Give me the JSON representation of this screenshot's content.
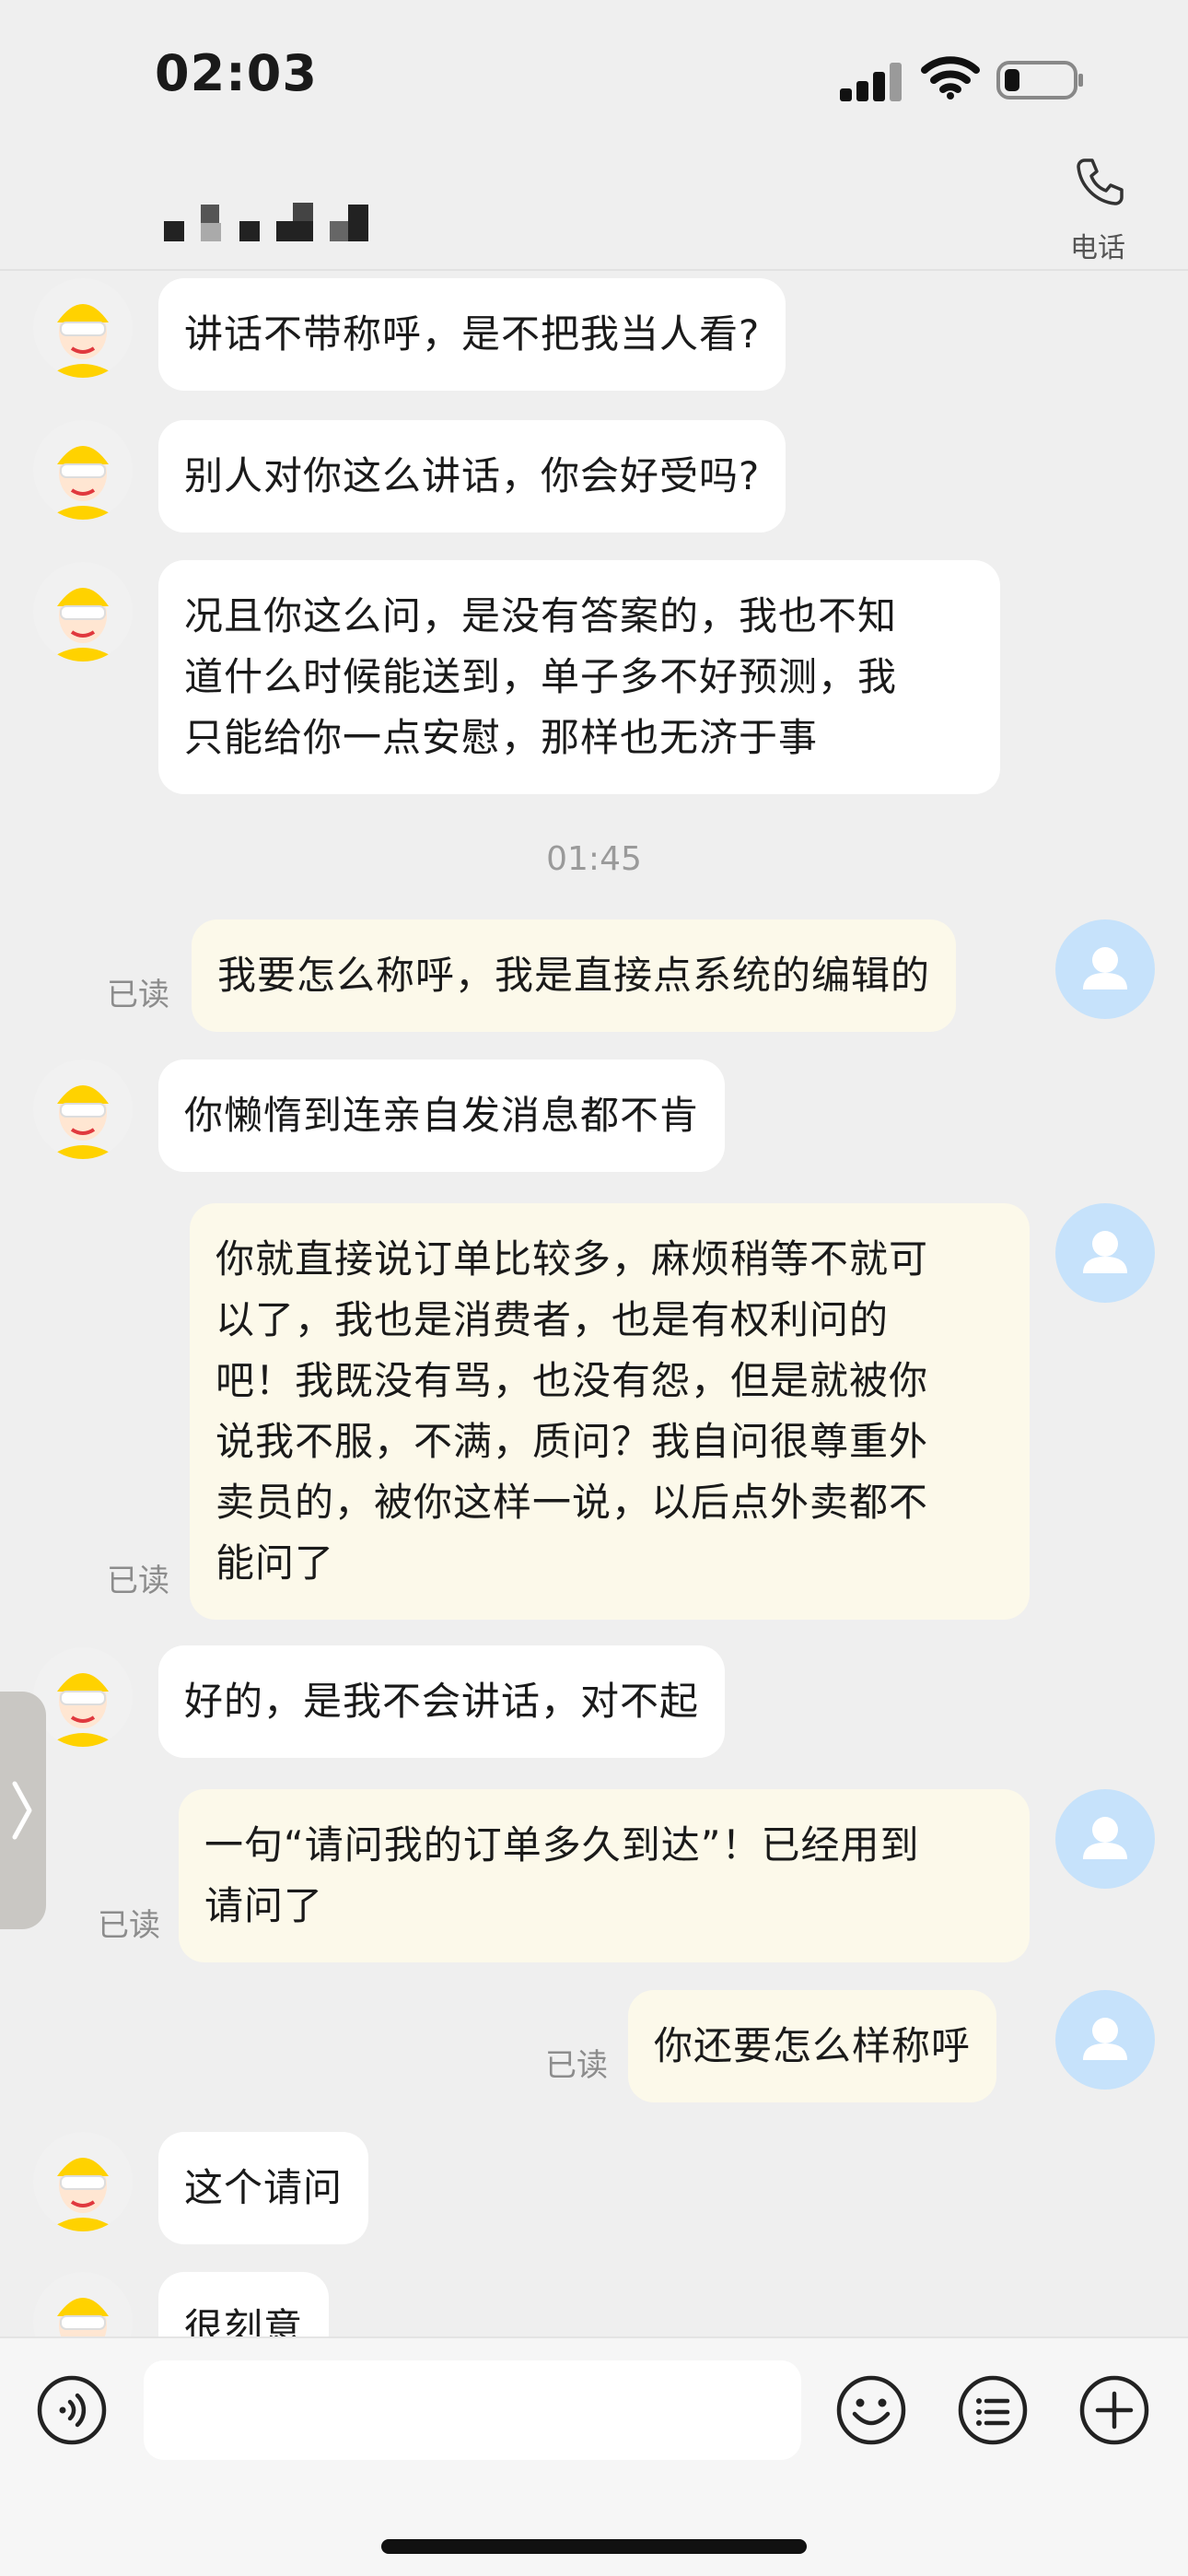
{
  "status_bar": {
    "time": "02:03"
  },
  "header": {
    "phone_label": "电话"
  },
  "messages": [
    {
      "side": "in",
      "text": "讲话不带称呼，是不把我当人看?"
    },
    {
      "side": "in",
      "text": "别人对你这么讲话，你会好受吗?"
    },
    {
      "side": "in",
      "lines": [
        "况且你这么问，是没有答案的，我也不知",
        "道什么时候能送到，单子多不好预测，我",
        "只能给你一点安慰，那样也无济于事"
      ]
    },
    {
      "side": "out",
      "text": "我要怎么称呼，我是直接点系统的编辑的",
      "status": "已读"
    },
    {
      "side": "in",
      "text": "你懒惰到连亲自发消息都不肯"
    },
    {
      "side": "out",
      "lines": [
        "你就直接说订单比较多，麻烦稍等不就可",
        "以了，我也是消费者，也是有权利问的",
        "吧！我既没有骂，也没有怨，但是就被你",
        "说我不服，不满，质问？我自问很尊重外",
        "卖员的，被你这样一说，以后点外卖都不",
        "能问了"
      ],
      "status": "已读"
    },
    {
      "side": "in",
      "text": "好的，是我不会讲话，对不起"
    },
    {
      "side": "out",
      "lines": [
        "一句“请问我的订单多久到达”！已经用到",
        "请问了"
      ],
      "status": "已读"
    },
    {
      "side": "out",
      "text": "你还要怎么样称呼",
      "status": "已读"
    },
    {
      "side": "in",
      "text": "这个请问"
    },
    {
      "side": "in",
      "text": "很刻意"
    }
  ],
  "timestamp": "01:45",
  "icons": {
    "voice": "voice-icon",
    "emoji": "emoji-icon",
    "menu": "list-menu-icon",
    "add": "plus-icon",
    "phone": "phone-icon",
    "side_handle": "chevron-right-icon"
  },
  "colors": {
    "background": "#efefef",
    "incoming_bubble": "#ffffff",
    "outgoing_bubble": "#fcf9ea",
    "user_avatar": "#c6e2fb",
    "courier_yellow": "#ffd200"
  }
}
